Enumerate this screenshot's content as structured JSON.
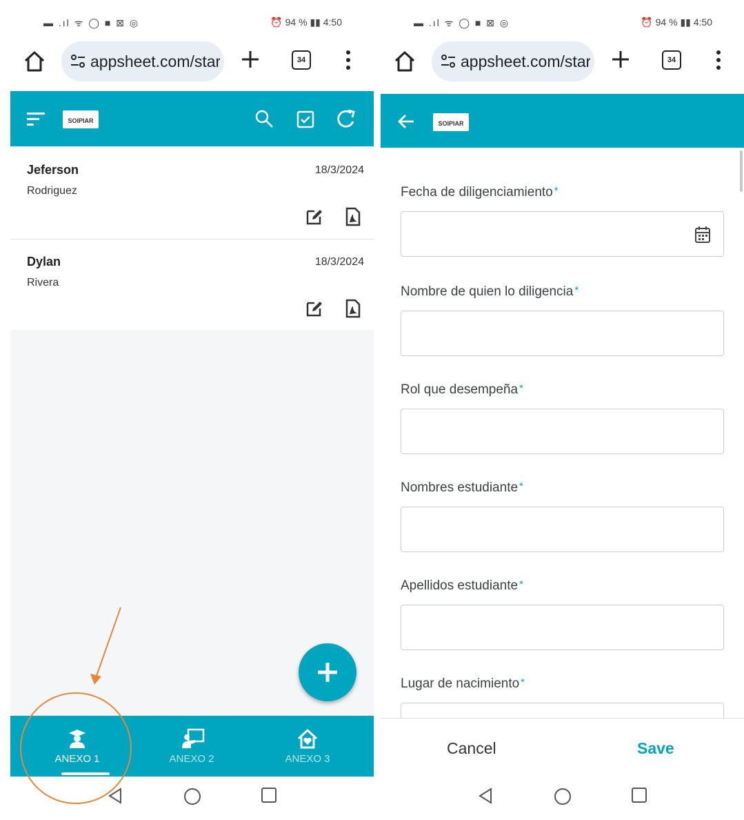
{
  "status_bar": {
    "left_icons": "▬ .ıl ᯤ ◯ ■ ⊠ ◎",
    "right_text": "⏰ 94 % ▮▮ 4:50"
  },
  "browser": {
    "url": "appsheet.com/start",
    "tab_count": "34"
  },
  "app": {
    "logo_text": "SOIPIAR",
    "accent_color": "#00a5c0"
  },
  "list": {
    "records": [
      {
        "first_name": "Jeferson",
        "last_name": "Rodriguez",
        "date": "18/3/2024"
      },
      {
        "first_name": "Dylan",
        "last_name": "Rivera",
        "date": "18/3/2024"
      }
    ]
  },
  "bottom_nav": {
    "items": [
      {
        "label": "ANEXO 1",
        "icon": "graduate-icon",
        "active": true
      },
      {
        "label": "ANEXO 2",
        "icon": "teacher-board-icon",
        "active": false
      },
      {
        "label": "ANEXO 3",
        "icon": "house-icon",
        "active": false
      }
    ]
  },
  "annotation": {
    "color": "#e8873a"
  },
  "form": {
    "fields": [
      {
        "label": "Fecha de diligenciamiento",
        "required_mark": "*",
        "type": "date"
      },
      {
        "label": "Nombre de quien lo diligencia",
        "required_mark": "*",
        "type": "text"
      },
      {
        "label": "Rol que desempeña",
        "required_mark": "*",
        "type": "text"
      },
      {
        "label": "Nombres estudiante",
        "required_mark": "*",
        "type": "text"
      },
      {
        "label": "Apellidos estudiante",
        "required_mark": "*",
        "type": "text"
      },
      {
        "label": "Lugar de nacimiento",
        "required_mark": "*",
        "type": "text"
      }
    ],
    "cancel_label": "Cancel",
    "save_label": "Save"
  }
}
